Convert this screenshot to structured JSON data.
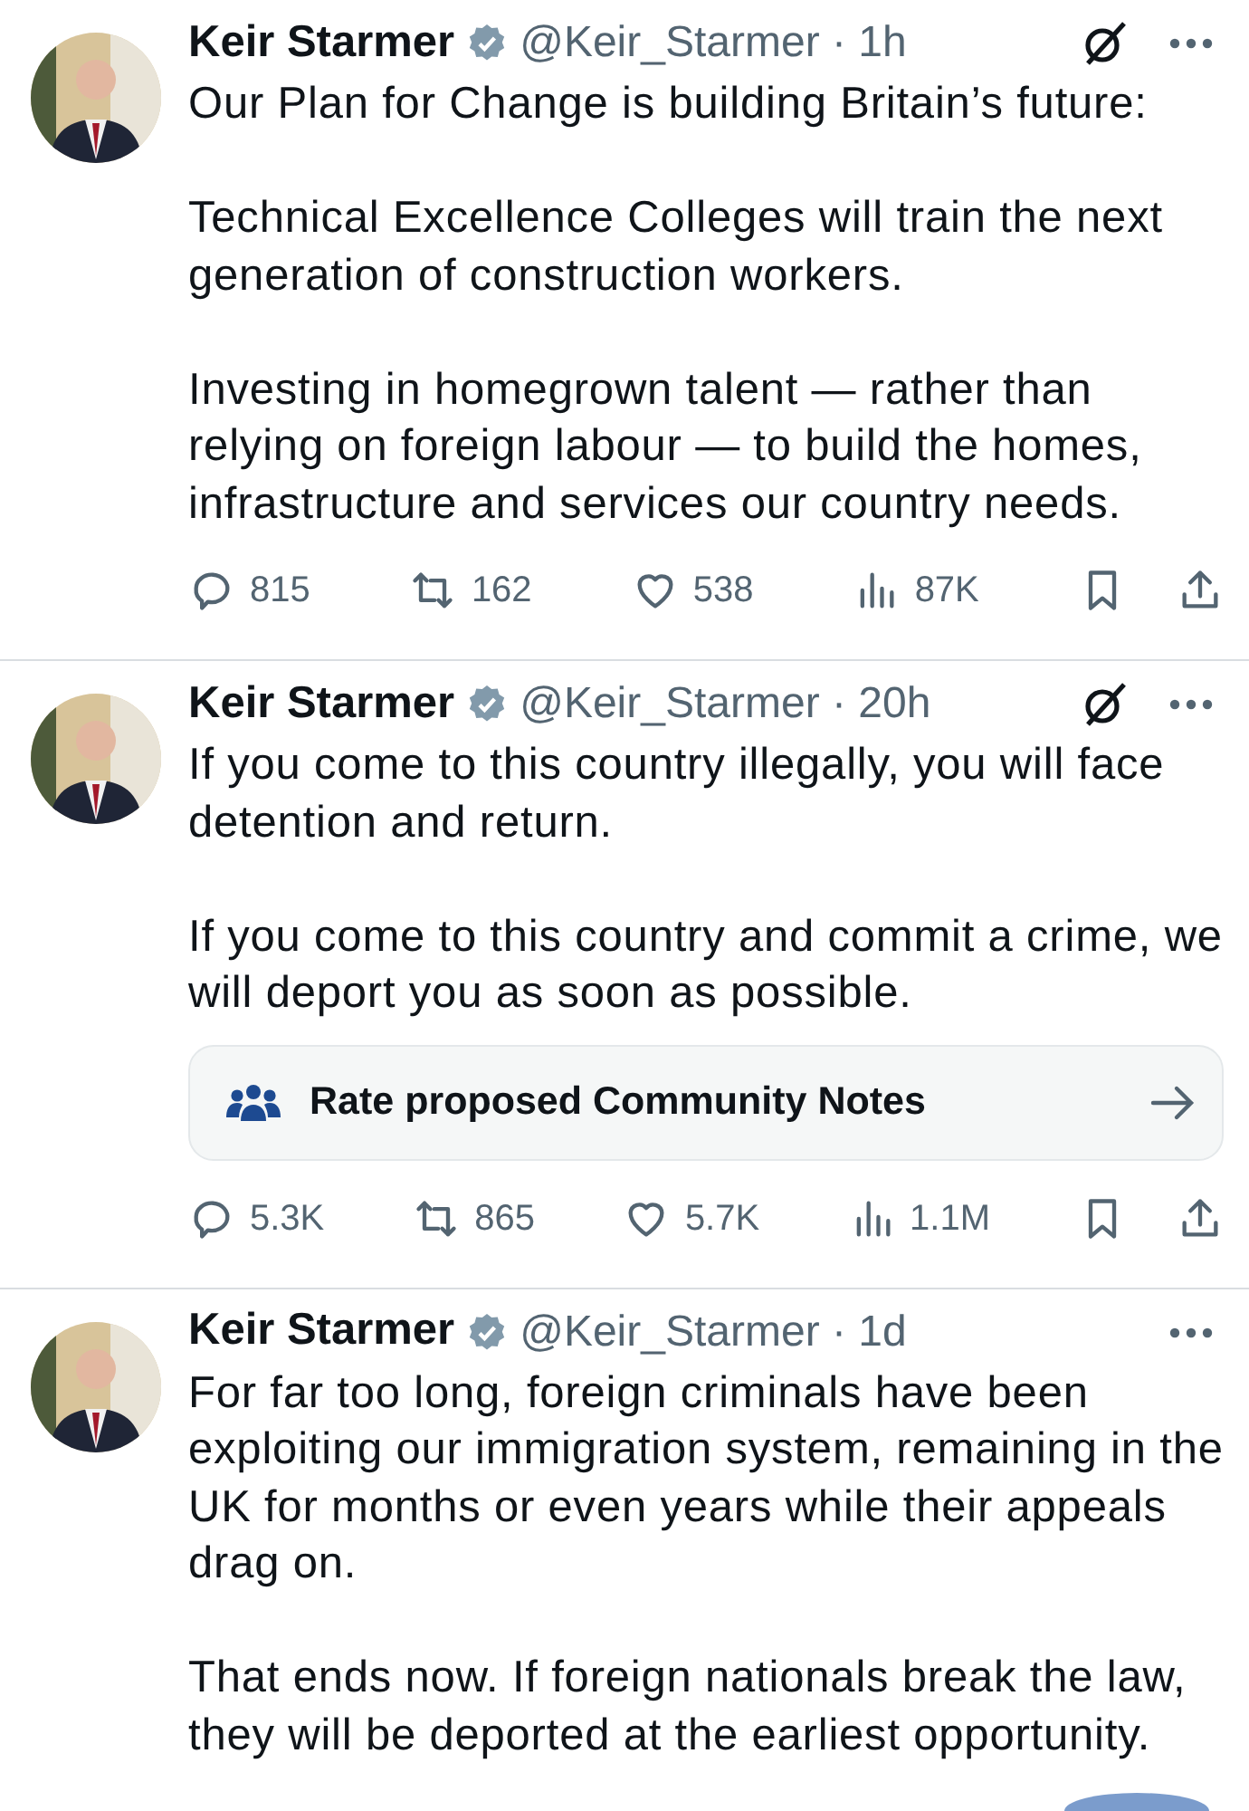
{
  "tweets": [
    {
      "author": "Keir Starmer",
      "verified": true,
      "meta": "@Keir_Starmer · 1h",
      "grok": true,
      "paragraphs": [
        "Our Plan for Change is building Britain’s future:",
        "Technical Excellence Colleges will train the next generation of construction workers.",
        "Investing in homegrown talent — rather than relying on foreign labour — to build the homes, infrastructure and services our country needs."
      ],
      "stats": {
        "replies": "815",
        "reposts": "162",
        "likes": "538",
        "views": "87K"
      }
    },
    {
      "author": "Keir Starmer",
      "verified": true,
      "meta": "@Keir_Starmer · 20h",
      "grok": true,
      "paragraphs": [
        "If you come to this country illegally, you will face detention and return.",
        "If you come to this country and commit a crime, we will deport you as soon as possible."
      ],
      "note": "Rate proposed Community Notes",
      "stats": {
        "replies": "5.3K",
        "reposts": "865",
        "likes": "5.7K",
        "views": "1.1M"
      }
    },
    {
      "author": "Keir Starmer",
      "verified": true,
      "meta": "@Keir_Starmer · 1d",
      "grok": false,
      "paragraphs": [
        "For far too long, foreign criminals have been exploiting our immigration system, remaining in the UK for months or even years while their appeals drag on.",
        "That ends now. If foreign nationals break the law, they will be deported at the earliest opportunity."
      ]
    }
  ],
  "floating_button": true
}
